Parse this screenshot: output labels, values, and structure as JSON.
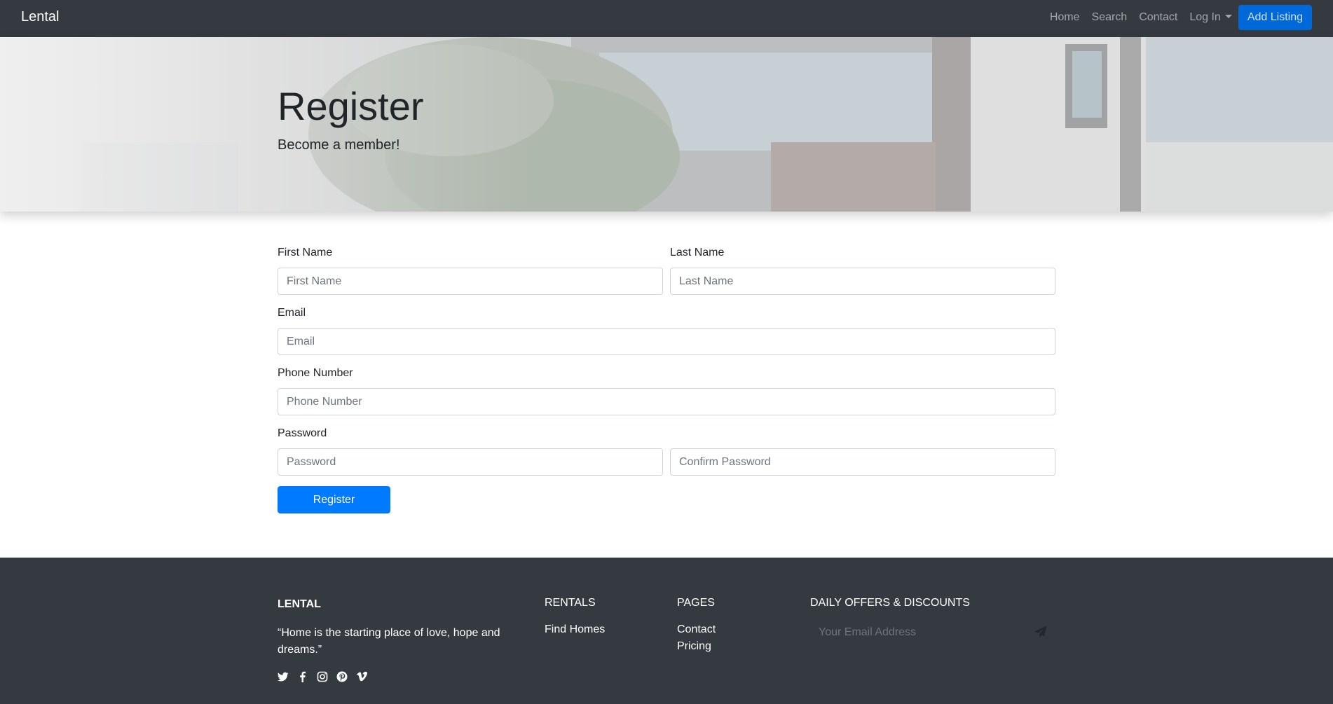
{
  "navbar": {
    "brand": "Lental",
    "links": [
      "Home",
      "Search",
      "Contact"
    ],
    "login_label": "Log In",
    "add_listing_label": "Add Listing"
  },
  "hero": {
    "title": "Register",
    "subtitle": "Become a member!"
  },
  "form": {
    "first_name_label": "First Name",
    "first_name_placeholder": "First Name",
    "last_name_label": "Last Name",
    "last_name_placeholder": "Last Name",
    "email_label": "Email",
    "email_placeholder": "Email",
    "phone_label": "Phone Number",
    "phone_placeholder": "Phone Number",
    "password_label": "Password",
    "password_placeholder": "Password",
    "confirm_password_placeholder": "Confirm Password",
    "submit_label": "Register"
  },
  "footer": {
    "brand": "LENTAL",
    "quote": "“Home is the starting place of love, hope and dreams.”",
    "social_icons": [
      "twitter-icon",
      "facebook-icon",
      "instagram-icon",
      "pinterest-icon",
      "vimeo-icon"
    ],
    "rentals_heading": "RENTALS",
    "rentals_links": [
      "Find Homes"
    ],
    "pages_heading": "PAGES",
    "pages_links": [
      "Contact",
      "Pricing"
    ],
    "newsletter_heading": "DAILY OFFERS & DISCOUNTS",
    "newsletter_placeholder": "Your Email Address"
  },
  "colors": {
    "navbar_bg": "#343a40",
    "primary": "#007bff",
    "footer_bg": "#343a40"
  }
}
